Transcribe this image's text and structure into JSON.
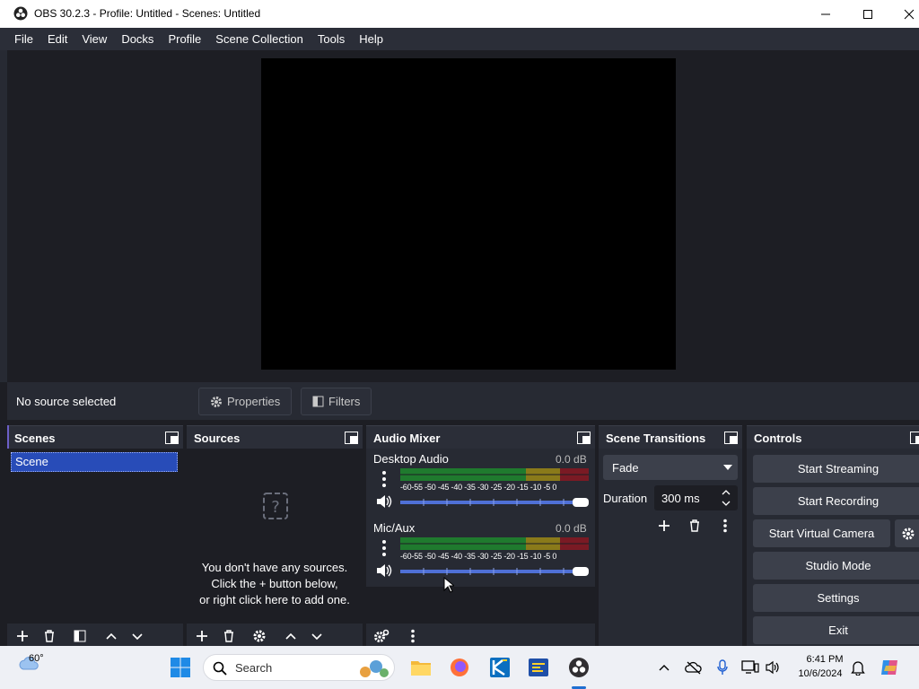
{
  "window": {
    "title": "OBS 30.2.3 - Profile: Untitled - Scenes: Untitled"
  },
  "menu": [
    "File",
    "Edit",
    "View",
    "Docks",
    "Profile",
    "Scene Collection",
    "Tools",
    "Help"
  ],
  "source_toolbar": {
    "no_source": "No source selected",
    "properties": "Properties",
    "filters": "Filters"
  },
  "scenes": {
    "title": "Scenes",
    "items": [
      "Scene"
    ]
  },
  "sources": {
    "title": "Sources",
    "empty_line1": "You don't have any sources.",
    "empty_line2": "Click the + button below,",
    "empty_line3": "or right click here to add one."
  },
  "mixer": {
    "title": "Audio Mixer",
    "tick_labels": "-60-55 -50 -45 -40 -35 -30 -25 -20 -15 -10  -5  0",
    "channels": [
      {
        "name": "Desktop Audio",
        "db": "0.0 dB",
        "volume": 1.0
      },
      {
        "name": "Mic/Aux",
        "db": "0.0 dB",
        "volume": 1.0
      }
    ]
  },
  "transitions": {
    "title": "Scene Transitions",
    "selected": "Fade",
    "duration_label": "Duration",
    "duration_value": "300 ms"
  },
  "controls": {
    "title": "Controls",
    "start_streaming": "Start Streaming",
    "start_recording": "Start Recording",
    "start_virtual_camera": "Start Virtual Camera",
    "studio_mode": "Studio Mode",
    "settings": "Settings",
    "exit": "Exit"
  },
  "taskbar": {
    "weather": "60°",
    "search": "Search",
    "time": "6:41 PM",
    "date": "10/6/2024"
  },
  "colors": {
    "accent": "#284cb8",
    "panel": "#272a33",
    "background": "#1d1e24",
    "meter_green": "#1f7a2e",
    "meter_yellow": "#8a7a1a",
    "meter_red": "#7a1a24",
    "slider": "#4f70d6"
  }
}
